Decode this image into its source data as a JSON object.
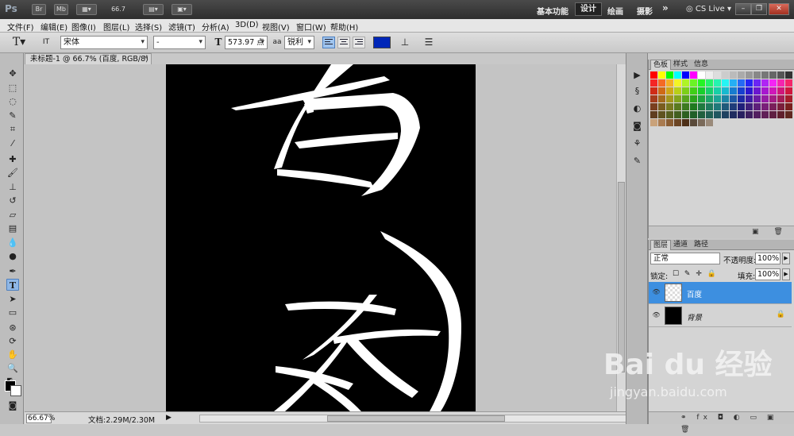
{
  "app": {
    "logo": "Ps",
    "zoom_value": "66.7"
  },
  "appbar": {
    "bridge": "Br",
    "minibridge": "Mb",
    "workspaces": [
      "基本功能",
      "设计",
      "绘画",
      "摄影"
    ],
    "active_workspace": "设计",
    "more": "»",
    "cslive": "CS Live",
    "window_buttons": [
      "–",
      "❐",
      "✕"
    ]
  },
  "menu": [
    "文件(F)",
    "编辑(E)",
    "图像(I)",
    "图层(L)",
    "选择(S)",
    "滤镜(T)",
    "分析(A)",
    "3D(D)",
    "视图(V)",
    "窗口(W)",
    "帮助(H)"
  ],
  "options": {
    "tool_icon": "T",
    "orient_icon": "IT",
    "font_family": "宋体",
    "font_style": "-",
    "size_icon": "T",
    "font_size": "573.97 点",
    "aa_icon": "aa",
    "antialias": "锐利",
    "text_color": "#0026b8",
    "warp_icon": "⊥",
    "panel_icon": "☰"
  },
  "document": {
    "tab_title": "未标题-1 @ 66.7% (百度, RGB/8) *",
    "close": "×",
    "canvas_color": "#000000",
    "text_color": "#ffffff"
  },
  "status": {
    "zoom": "66.67%",
    "doc_info": "文档:2.29M/2.30M"
  },
  "panels": {
    "swatch_tabs": [
      "色板",
      "样式",
      "信息"
    ],
    "layer_tabs": [
      "图层",
      "通道",
      "路径"
    ],
    "blend_mode": "正常",
    "opacity_label": "不透明度:",
    "opacity": "100%",
    "lock_label": "锁定:",
    "lock_icons": "☐ ✎ ✛ 🔒",
    "fill_label": "填充:",
    "fill": "100%",
    "layers": [
      {
        "name": "百度",
        "selected": true
      },
      {
        "name": "背景",
        "selected": false
      }
    ],
    "footer_icons": "⚭ fx ◘ ◐ ▭ ▣ 🗑"
  },
  "watermark": {
    "brand": "Bai du 经验",
    "url": "jingyan.baidu.com"
  }
}
